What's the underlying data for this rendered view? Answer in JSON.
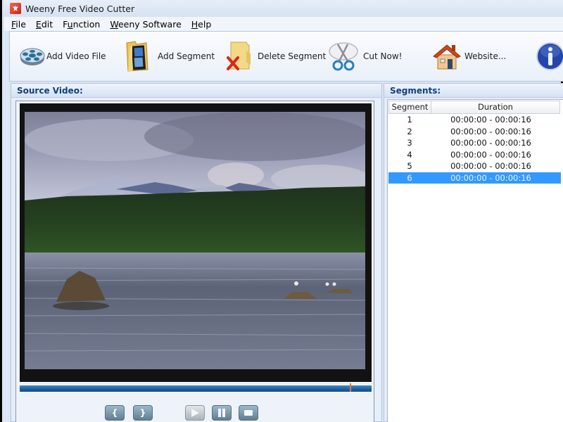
{
  "window": {
    "title": "Weeny Free Video Cutter"
  },
  "menu": [
    {
      "label": "File",
      "accel": "F",
      "rest": "ile"
    },
    {
      "label": "Edit",
      "accel": "E",
      "rest": "dit"
    },
    {
      "label": "Function",
      "pre": "F",
      "accel": "u",
      "rest": "nction"
    },
    {
      "label": "Weeny Software",
      "accel": "W",
      "rest": "eeny Software"
    },
    {
      "label": "Help",
      "accel": "H",
      "rest": "elp"
    }
  ],
  "toolbar": {
    "add_video": "Add Video File",
    "add_segment": "Add Segment",
    "delete_segment": "Delete Segment",
    "cut_now": "Cut Now!",
    "website": "Website...",
    "about_icon": "info-icon"
  },
  "source_panel": {
    "title": "Source Video:",
    "seek_progress_percent": 94,
    "controls": {
      "mark_start": "{",
      "mark_end": "}",
      "play": "play",
      "pause": "pause",
      "stop": "stop"
    }
  },
  "segments_panel": {
    "title": "Segments:",
    "columns": [
      "Segment",
      "Duration"
    ],
    "rows": [
      {
        "segment": "1",
        "duration": "00:00:00 - 00:00:16",
        "selected": false
      },
      {
        "segment": "2",
        "duration": "00:00:00 - 00:00:16",
        "selected": false
      },
      {
        "segment": "3",
        "duration": "00:00:00 - 00:00:16",
        "selected": false
      },
      {
        "segment": "4",
        "duration": "00:00:00 - 00:00:16",
        "selected": false
      },
      {
        "segment": "5",
        "duration": "00:00:00 - 00:00:16",
        "selected": false
      },
      {
        "segment": "6",
        "duration": "00:00:00 - 00:00:16",
        "selected": true
      }
    ]
  },
  "colors": {
    "selection": "#3399ff",
    "header_text": "#153f7a",
    "seekbar": "#1f5d9e",
    "seek_marker": "#e07a2a"
  }
}
